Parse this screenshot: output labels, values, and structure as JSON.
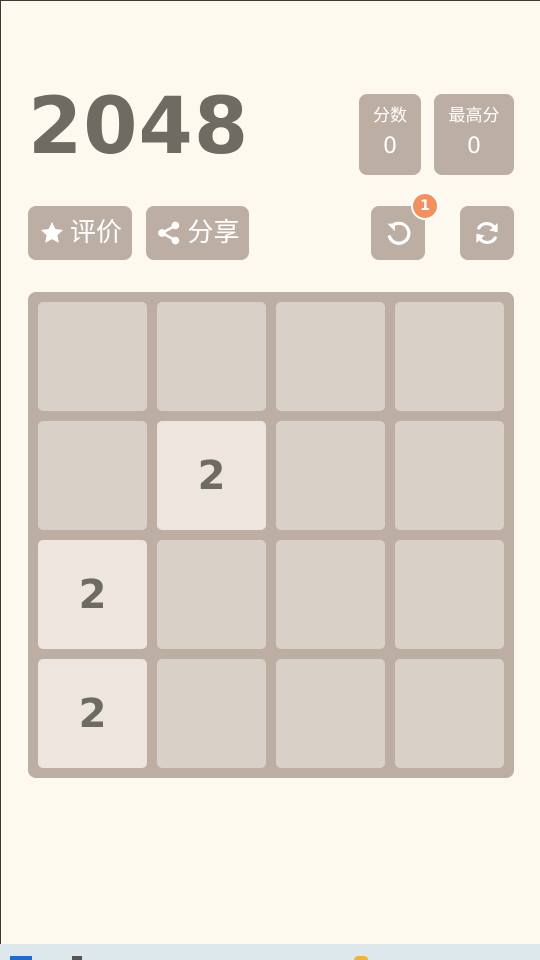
{
  "game": {
    "title": "2048"
  },
  "scores": {
    "score_label": "分数",
    "score_value": "0",
    "best_label": "最高分",
    "best_value": "0"
  },
  "buttons": {
    "rate_label": "评价",
    "share_label": "分享",
    "undo_badge": "1",
    "rate_icon": "star-icon",
    "share_icon": "share-icon",
    "undo_icon": "undo-icon",
    "restart_icon": "refresh-icon"
  },
  "board": {
    "size": 4,
    "grid": [
      [
        "",
        "",
        "",
        ""
      ],
      [
        "",
        "2",
        "",
        ""
      ],
      [
        "2",
        "",
        "",
        ""
      ],
      [
        "2",
        "",
        "",
        ""
      ]
    ]
  },
  "colors": {
    "background": "#fdf9ee",
    "board": "#bcaea3",
    "empty_cell": "#d9d1c7",
    "tile_2": "#eee6de",
    "text": "#6e6b62",
    "badge": "#f4905d"
  }
}
